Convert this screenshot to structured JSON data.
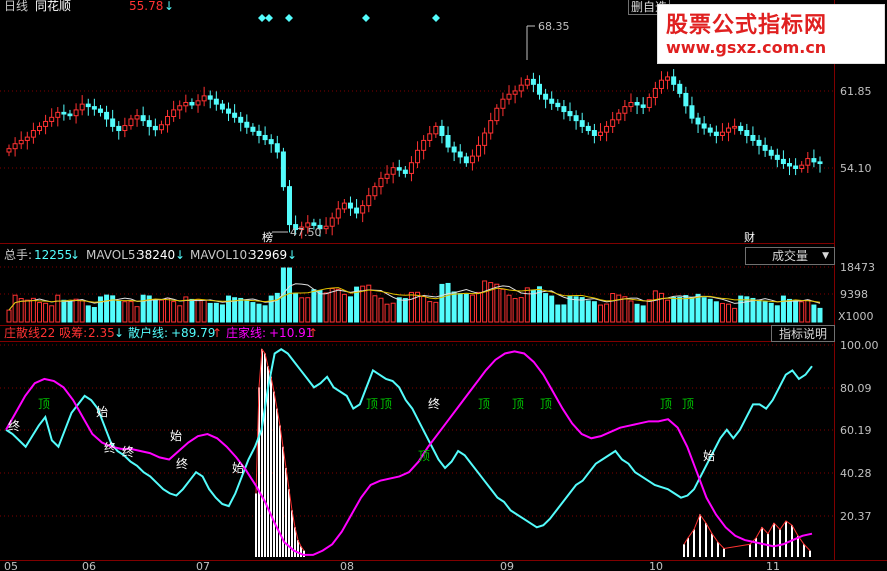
{
  "header": {
    "period": "日线",
    "stock_name": "同花顺",
    "top_value": "55.78",
    "top_arrow": "↓",
    "partial_button": "删自选"
  },
  "watermark": {
    "title": "股票公式指标网",
    "url": "www.gsxz.com.cn"
  },
  "volume_header": {
    "total_label": "总手:",
    "total_value": "12255",
    "mavol5_label": "MAVOL5:",
    "mavol5_value": "38240",
    "mavol10_label": "MAVOL10:",
    "mavol10_value": "32969",
    "arrow": "↓",
    "indicator_button": "成交量",
    "dropdown_icon": "triangle-down-icon"
  },
  "indicator_header": {
    "line1_label": "庄散线22 吸筹:",
    "line1_value": "2.35",
    "line1_arrow": "↓",
    "line2_label": "散户线:",
    "line2_value": "+89.79",
    "line2_arrow": "↑",
    "line3_label": "庄家线:",
    "line3_value": "+10.91",
    "line3_arrow": "↑",
    "explain_button": "指标说明"
  },
  "colors": {
    "up": "#ff3232",
    "down": "#54fcfc",
    "magenta": "#ff00ff",
    "cyan_line": "#54fcfc",
    "grid": "#800000",
    "label_green": "#00c000"
  },
  "chart_data": [
    {
      "type": "candlestick",
      "title": "日线",
      "y_ticks": [
        "61.85",
        "54.10"
      ],
      "annotations": {
        "high": "68.35",
        "low": "47.50",
        "low_marker": "榜",
        "right_marker": "财"
      },
      "closes": [
        57.6,
        58.2,
        58.6,
        59.0,
        59.8,
        60.3,
        60.9,
        61.4,
        62.0,
        61.8,
        61.6,
        62.3,
        63.0,
        62.7,
        62.4,
        62.0,
        61.2,
        60.3,
        59.8,
        60.4,
        61.2,
        61.6,
        61.0,
        60.3,
        59.9,
        60.5,
        61.5,
        62.3,
        62.8,
        63.2,
        62.9,
        63.4,
        64.0,
        63.6,
        63.0,
        62.4,
        61.9,
        61.4,
        60.8,
        60.2,
        59.7,
        59.2,
        58.7,
        58.2,
        57.2,
        53.0,
        48.4,
        47.8,
        48.1,
        48.6,
        48.3,
        47.9,
        48.2,
        49.2,
        50.3,
        51.0,
        50.4,
        49.8,
        50.7,
        51.9,
        53.0,
        54.0,
        54.5,
        55.3,
        55.0,
        54.6,
        55.9,
        57.4,
        58.6,
        59.4,
        60.3,
        59.2,
        57.8,
        57.2,
        56.6,
        55.9,
        56.7,
        58.0,
        59.5,
        61.0,
        62.5,
        63.6,
        64.2,
        64.6,
        65.3,
        66.0,
        65.4,
        64.2,
        63.6,
        63.1,
        62.7,
        62.1,
        61.6,
        61.0,
        60.3,
        59.8,
        59.2,
        59.6,
        60.3,
        61.1,
        61.9,
        62.7,
        63.2,
        62.9,
        62.6,
        63.8,
        64.9,
        65.9,
        66.3,
        65.4,
        64.3,
        62.8,
        61.3,
        60.6,
        60.1,
        59.6,
        59.2,
        59.6,
        60.1,
        60.3,
        59.8,
        59.2,
        58.6,
        58.0,
        57.4,
        56.8,
        56.3,
        55.8,
        55.5,
        55.2,
        55.6,
        56.4,
        56.0,
        55.8
      ]
    },
    {
      "type": "bar",
      "title": "成交量",
      "y_ticks": [
        "18473",
        "9398"
      ],
      "unit": "X1000"
    },
    {
      "type": "line",
      "title": "庄散线22",
      "y_ticks": [
        "100.00",
        "80.09",
        "60.19",
        "40.28",
        "20.37"
      ],
      "x_ticks": [
        "05",
        "06",
        "07",
        "08",
        "09",
        "10",
        "11"
      ],
      "series": [
        {
          "name": "散户线",
          "values": [
            60,
            58,
            55,
            52,
            57,
            62,
            66,
            55,
            52,
            60,
            68,
            72,
            76,
            74,
            70,
            62,
            54,
            50,
            48,
            45,
            43,
            40,
            38,
            35,
            32,
            30,
            29,
            32,
            36,
            40,
            38,
            32,
            28,
            25,
            24,
            30,
            38,
            46,
            52,
            60,
            80,
            96,
            98,
            96,
            92,
            88,
            84,
            80,
            82,
            85,
            80,
            78,
            76,
            70,
            72,
            80,
            88,
            86,
            84,
            83,
            80,
            74,
            70,
            64,
            58,
            52,
            46,
            42,
            45,
            50,
            48,
            44,
            40,
            36,
            32,
            28,
            26,
            22,
            20,
            18,
            16,
            14,
            15,
            18,
            22,
            26,
            30,
            34,
            36,
            40,
            44,
            46,
            48,
            50,
            46,
            44,
            40,
            38,
            36,
            34,
            33,
            32,
            30,
            28,
            29,
            32,
            38,
            44,
            50,
            56,
            60,
            56,
            60,
            66,
            72,
            72,
            70,
            74,
            80,
            86,
            88,
            84,
            86,
            90
          ]
        },
        {
          "name": "庄家线",
          "values": [
            60,
            68,
            76,
            82,
            84,
            83,
            80,
            74,
            66,
            58,
            54,
            52,
            51,
            51,
            50,
            49,
            47,
            46,
            50,
            54,
            57,
            58,
            56,
            52,
            47,
            41,
            34,
            26,
            16,
            7,
            3,
            1,
            1,
            3,
            6,
            12,
            20,
            28,
            34,
            36,
            37,
            38,
            40,
            45,
            52,
            58,
            64,
            70,
            76,
            82,
            88,
            93,
            96,
            97,
            96,
            92,
            86,
            78,
            70,
            63,
            58,
            56,
            57,
            59,
            61,
            62,
            63,
            64,
            64,
            65,
            61,
            52,
            40,
            28,
            20,
            14,
            10,
            8,
            7,
            6,
            5,
            6,
            8,
            10,
            11
          ]
        }
      ],
      "labels": [
        "终",
        "顶",
        "始",
        "终",
        "终",
        "始",
        "终",
        "始",
        "顶",
        "顶",
        "终",
        "顶",
        "顶",
        "顶",
        "顶",
        "顶",
        "顶",
        "始"
      ]
    }
  ]
}
